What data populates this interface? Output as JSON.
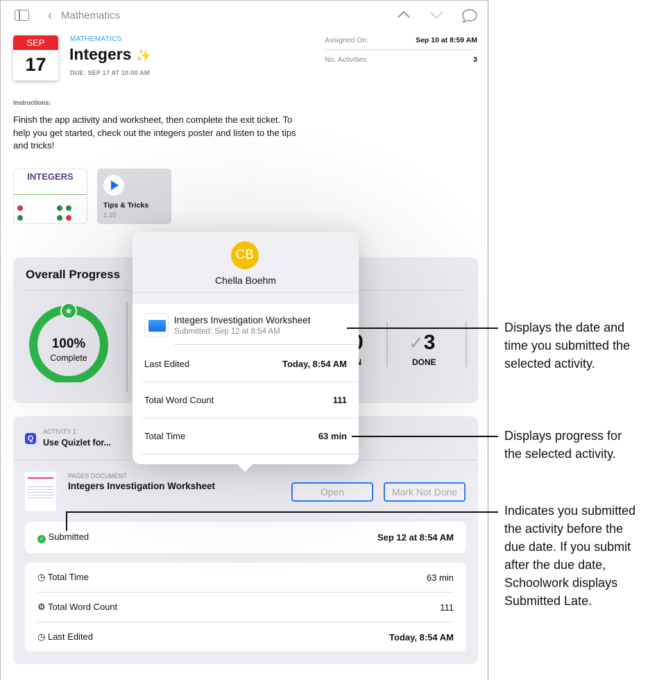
{
  "nav": {
    "back_label": "Mathematics"
  },
  "header": {
    "calendar_month": "SEP",
    "calendar_day": "17",
    "subject": "MATHEMATICS",
    "title": "Integers",
    "title_emoji": "✨",
    "due": "DUE: SEP 17 AT 10:00 AM"
  },
  "meta": {
    "assigned_label": "Assigned On:",
    "assigned_value": "Sep 10 at 8:59 AM",
    "activities_label": "No. Activities:",
    "activities_value": "3"
  },
  "instructions": {
    "label": "Instructions:",
    "text": "Finish the app activity and worksheet, then complete the exit ticket. To help you get started, check out the integers poster and listen to the tips and tricks!"
  },
  "attachments": [
    {
      "title": "INTEGERS"
    },
    {
      "title": "Tips & Tricks",
      "duration": "1:20"
    }
  ],
  "progress": {
    "title": "Overall Progress",
    "percent": 100,
    "percent_label": "100%",
    "complete_label": "Complete",
    "in_value": "0",
    "in_label": "IN",
    "done_value": "3",
    "done_label": "DONE"
  },
  "activity": {
    "number": "ACTIVITY 1",
    "title": "Use Quizlet for...",
    "doc_type": "PAGES DOCUMENT",
    "doc_title": "Integers Investigation Worksheet",
    "open_label": "Open",
    "mark_label": "Mark Not Done",
    "submitted_label": "Submitted",
    "submitted_value": "Sep 12 at 8:54 AM",
    "stats": [
      {
        "label": "Total Time",
        "value": "63 min"
      },
      {
        "label": "Total Word Count",
        "value": "111"
      },
      {
        "label": "Last Edited",
        "value": "Today, 8:54 AM"
      }
    ]
  },
  "popover": {
    "initials": "CB",
    "name": "Chella Boehm",
    "file_title": "Integers Investigation Worksheet",
    "file_sub": "Submitted: Sep 12 at 8:54 AM",
    "rows": [
      {
        "label": "Last Edited",
        "value": "Today, 8:54 AM"
      },
      {
        "label": "Total Word Count",
        "value": "111"
      },
      {
        "label": "Total Time",
        "value": "63 min"
      }
    ]
  },
  "colors": {
    "accent": "#3478f6",
    "calendar_red": "#e8262b",
    "progress_green": "#2db84b",
    "avatar_yellow": "#f5c000"
  },
  "callouts": [
    {
      "lines": [
        "Displays the date and",
        "time you submitted the",
        "selected activity."
      ]
    },
    {
      "lines": [
        "Displays progress for",
        "the selected activity."
      ]
    },
    {
      "lines": [
        "Indicates you submitted",
        "the activity before the",
        "due date. If you submit",
        "after the due date,",
        "Schoolwork displays",
        "Submitted Late."
      ]
    }
  ]
}
